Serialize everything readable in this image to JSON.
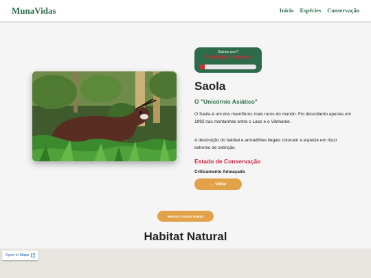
{
  "header": {
    "brand": "MunaVidas",
    "nav": [
      "Início",
      "Espécies",
      "Conservação"
    ]
  },
  "fact_card": {
    "title": "Sabias que?",
    "warning": "População pequena",
    "level_percent": 8,
    "colors": {
      "card": "#2e6b4a",
      "bar": "#e0242e"
    }
  },
  "species": {
    "name": "Saola",
    "nickname": "O \"Unicórnio Asiático\"",
    "description": "O Saola é um dos mamíferos mais raros do mundo. Foi descoberto apenas em 1992 nas montanhas entre o Laos e o Vietname.",
    "threat": "A destruição do habitat e armadilhas ilegais colocam a espécie em risco extremo de extinção.",
    "status_heading": "Estado de Conservação",
    "status_value": "Criticamente Ameaçado",
    "photo_icon": "saola-photo"
  },
  "buttons": {
    "back": "← Voltar",
    "toggle_habitat": "Mostrar / Ocultar Habitat"
  },
  "habitat": {
    "title": "Habitat Natural",
    "maps_link": "Open in Maps"
  },
  "colors": {
    "brand": "#2e6b4a",
    "accent": "#e2a24a",
    "danger": "#d0223a"
  }
}
